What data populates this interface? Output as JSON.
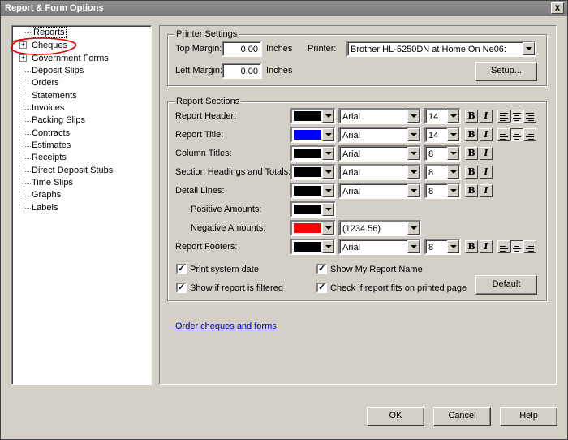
{
  "window": {
    "title": "Report & Form Options",
    "close": "x"
  },
  "tree": {
    "items": [
      {
        "label": "Reports",
        "expandable": false,
        "selected": true
      },
      {
        "label": "Cheques",
        "expandable": true,
        "selected": false
      },
      {
        "label": "Government Forms",
        "expandable": true,
        "selected": false
      },
      {
        "label": "Deposit Slips",
        "expandable": false,
        "selected": false
      },
      {
        "label": "Orders",
        "expandable": false,
        "selected": false
      },
      {
        "label": "Statements",
        "expandable": false,
        "selected": false
      },
      {
        "label": "Invoices",
        "expandable": false,
        "selected": false
      },
      {
        "label": "Packing Slips",
        "expandable": false,
        "selected": false
      },
      {
        "label": "Contracts",
        "expandable": false,
        "selected": false
      },
      {
        "label": "Estimates",
        "expandable": false,
        "selected": false
      },
      {
        "label": "Receipts",
        "expandable": false,
        "selected": false
      },
      {
        "label": "Direct Deposit Stubs",
        "expandable": false,
        "selected": false
      },
      {
        "label": "Time Slips",
        "expandable": false,
        "selected": false
      },
      {
        "label": "Graphs",
        "expandable": false,
        "selected": false
      },
      {
        "label": "Labels",
        "expandable": false,
        "selected": false
      }
    ],
    "plus_glyph": "+"
  },
  "printer_settings": {
    "legend": "Printer Settings",
    "top_margin_label": "Top Margin:",
    "top_margin_value": "0.00",
    "left_margin_label": "Left Margin:",
    "left_margin_value": "0.00",
    "units": "Inches",
    "printer_label": "Printer:",
    "printer_value": "Brother HL-5250DN at Home On Ne06:",
    "setup_button": "Setup..."
  },
  "report_sections": {
    "legend": "Report Sections",
    "rows": [
      {
        "label": "Report Header:",
        "color": "#000000",
        "font": "Arial",
        "size": "14",
        "align": true,
        "align_selected": "left"
      },
      {
        "label": "Report Title:",
        "color": "#0000ff",
        "font": "Arial",
        "size": "14",
        "align": true,
        "align_selected": "left"
      },
      {
        "label": "Column Titles:",
        "color": "#000000",
        "font": "Arial",
        "size": "8",
        "align": false
      },
      {
        "label": "Section Headings and Totals:",
        "color": "#000000",
        "font": "Arial",
        "size": "8",
        "align": false
      },
      {
        "label": "Detail Lines:",
        "color": "#000000",
        "font": "Arial",
        "size": "8",
        "align": false
      },
      {
        "label": "Positive Amounts:",
        "color": "#000000"
      },
      {
        "label": "Negative Amounts:",
        "color": "#ff0000",
        "format": "(1234.56)"
      },
      {
        "label": "Report Footers:",
        "color": "#000000",
        "font": "Arial",
        "size": "8",
        "align": true,
        "align_selected": "left"
      }
    ],
    "bold_glyph": "B",
    "italic_glyph": "I",
    "print_system_date": "Print system date",
    "show_if_filtered": "Show if report is filtered",
    "show_report_name": "Show My Report Name",
    "check_fits_page": "Check if report fits on printed page",
    "default_button": "Default"
  },
  "order_link": "Order cheques and forms",
  "footer": {
    "ok": "OK",
    "cancel": "Cancel",
    "help": "Help"
  },
  "colors": {
    "titlebar": "#7a7a7a",
    "dialog": "#d4d0c8",
    "link": "#0000cc",
    "annotation": "#e00000"
  }
}
